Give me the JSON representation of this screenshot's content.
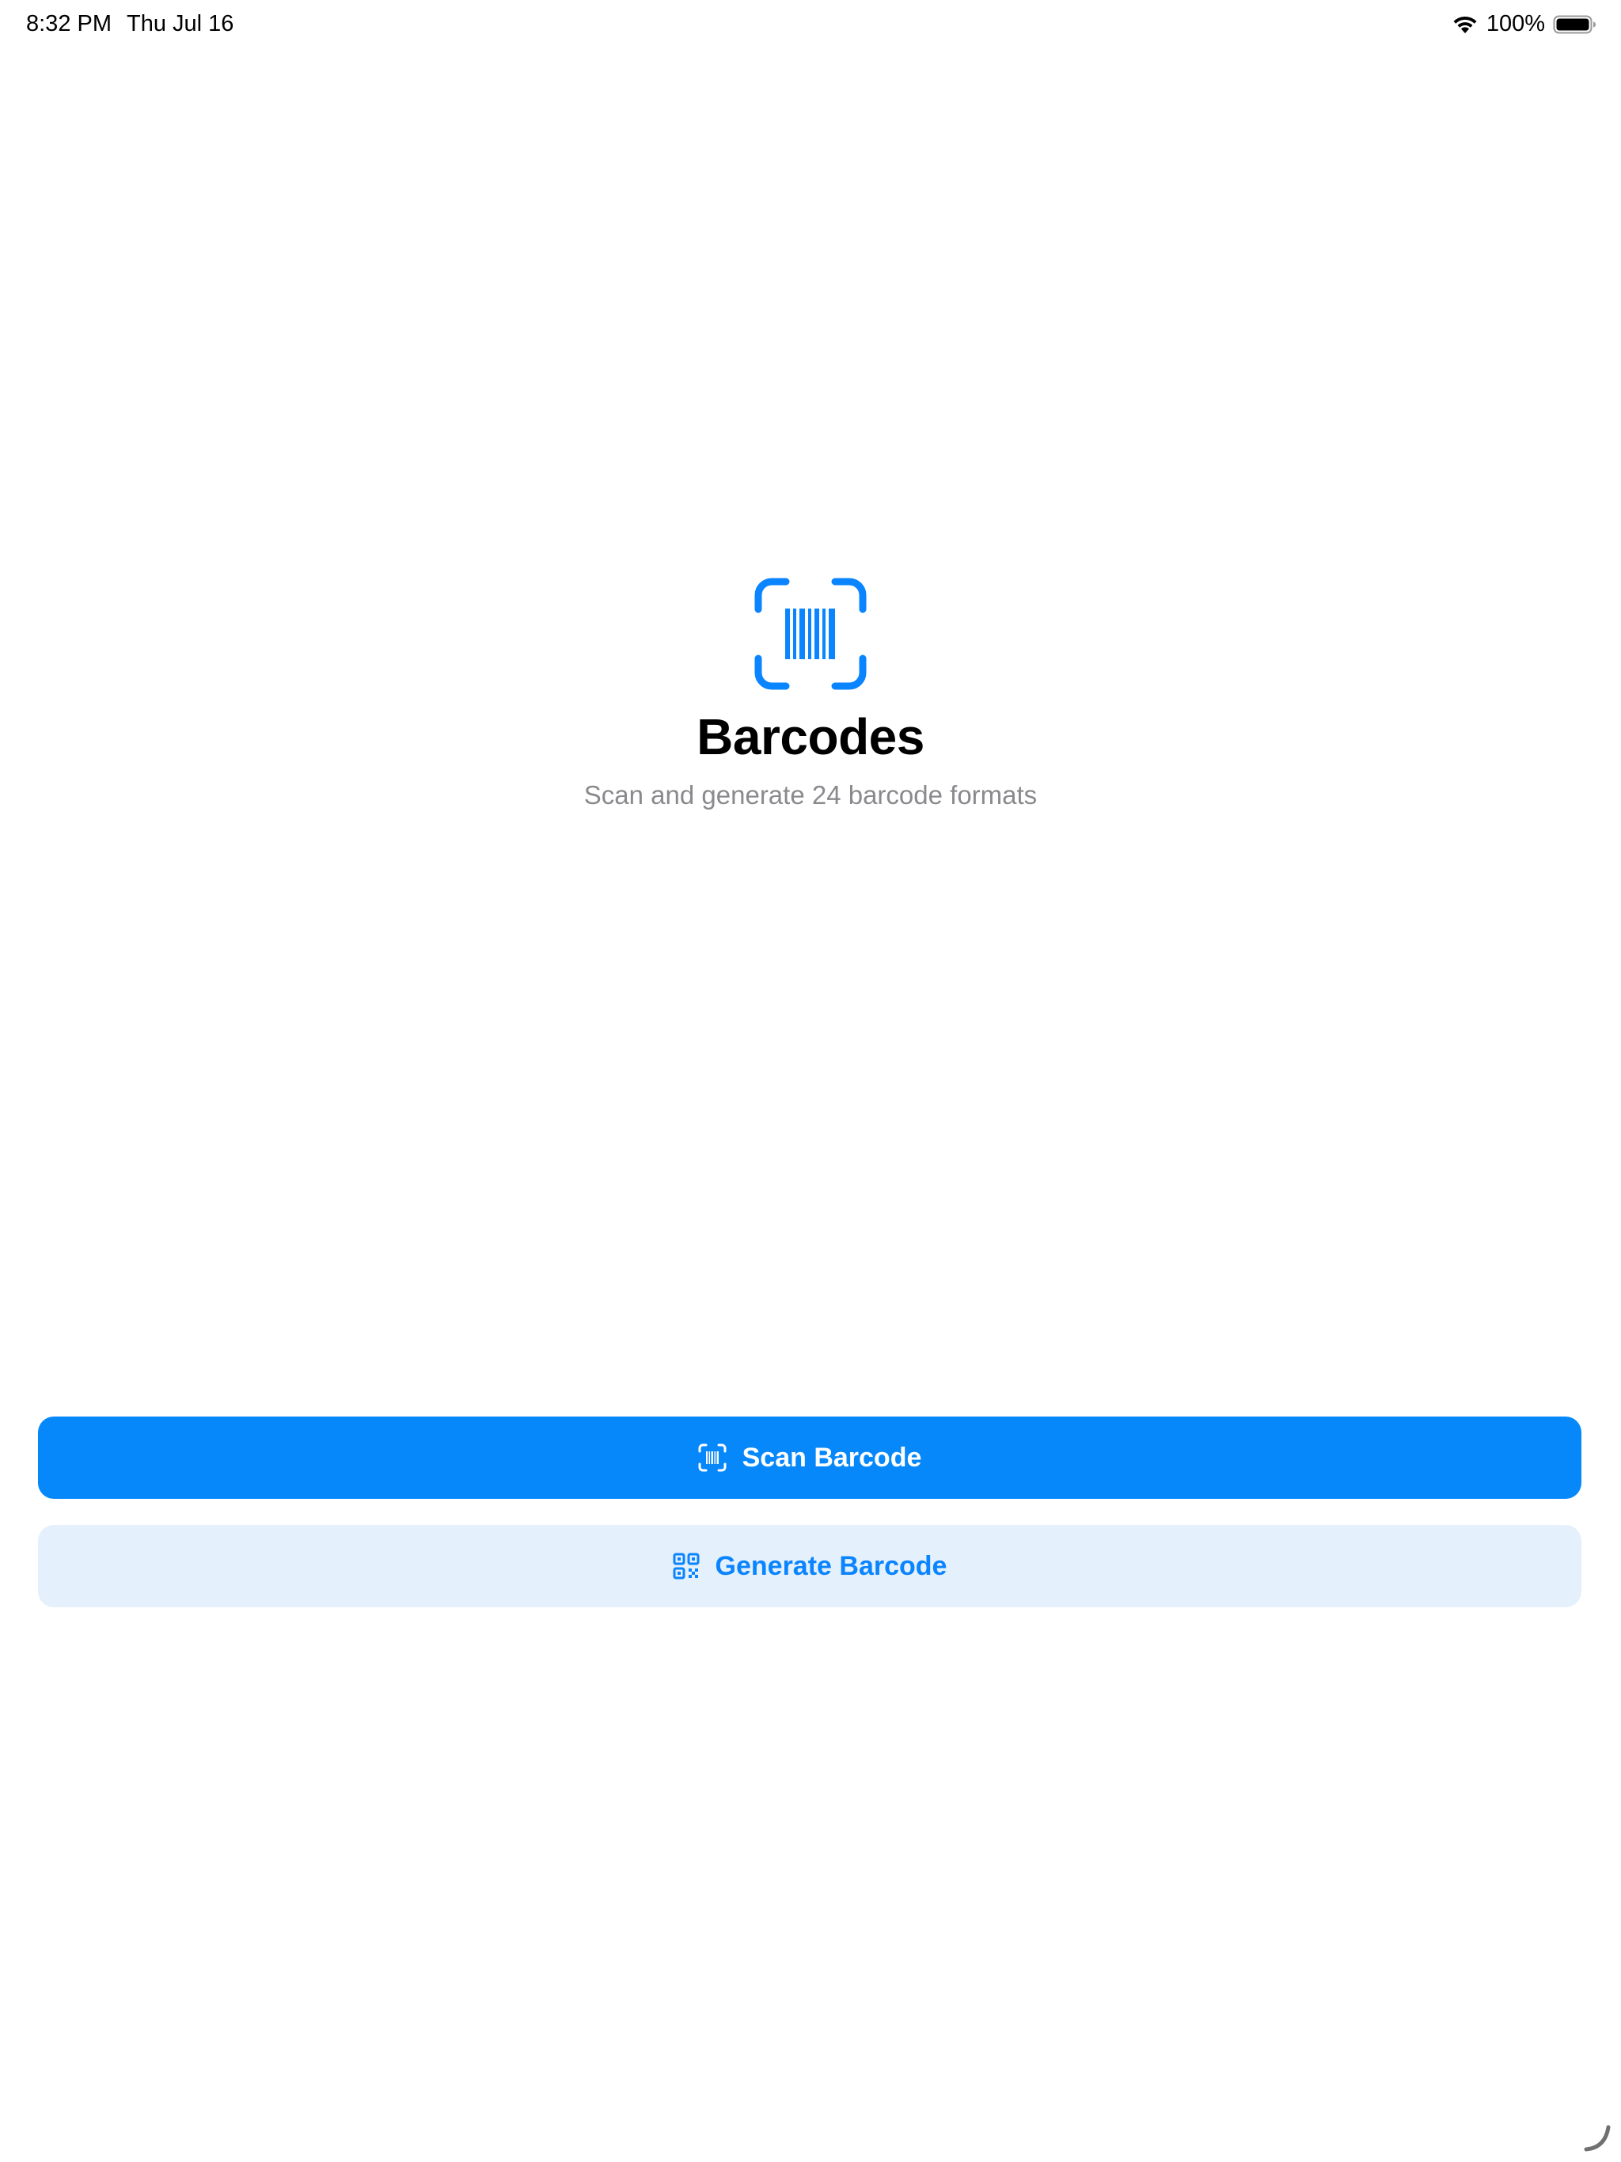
{
  "status_bar": {
    "time": "8:32 PM",
    "date": "Thu Jul 16",
    "battery_percent": "100%",
    "wifi_icon": "wifi-icon",
    "battery_icon": "battery-full-icon"
  },
  "hero": {
    "icon": "barcode-viewfinder-icon",
    "title": "Barcodes",
    "subtitle": "Scan and generate 24 barcode formats"
  },
  "actions": {
    "scan": {
      "label": "Scan Barcode",
      "icon": "barcode-viewfinder-icon"
    },
    "generate": {
      "label": "Generate Barcode",
      "icon": "qrcode-icon"
    }
  },
  "colors": {
    "accent": "#0A84FF",
    "secondary_button_bg": "#E4F1FC",
    "subtitle_text": "#8A8A8E"
  }
}
